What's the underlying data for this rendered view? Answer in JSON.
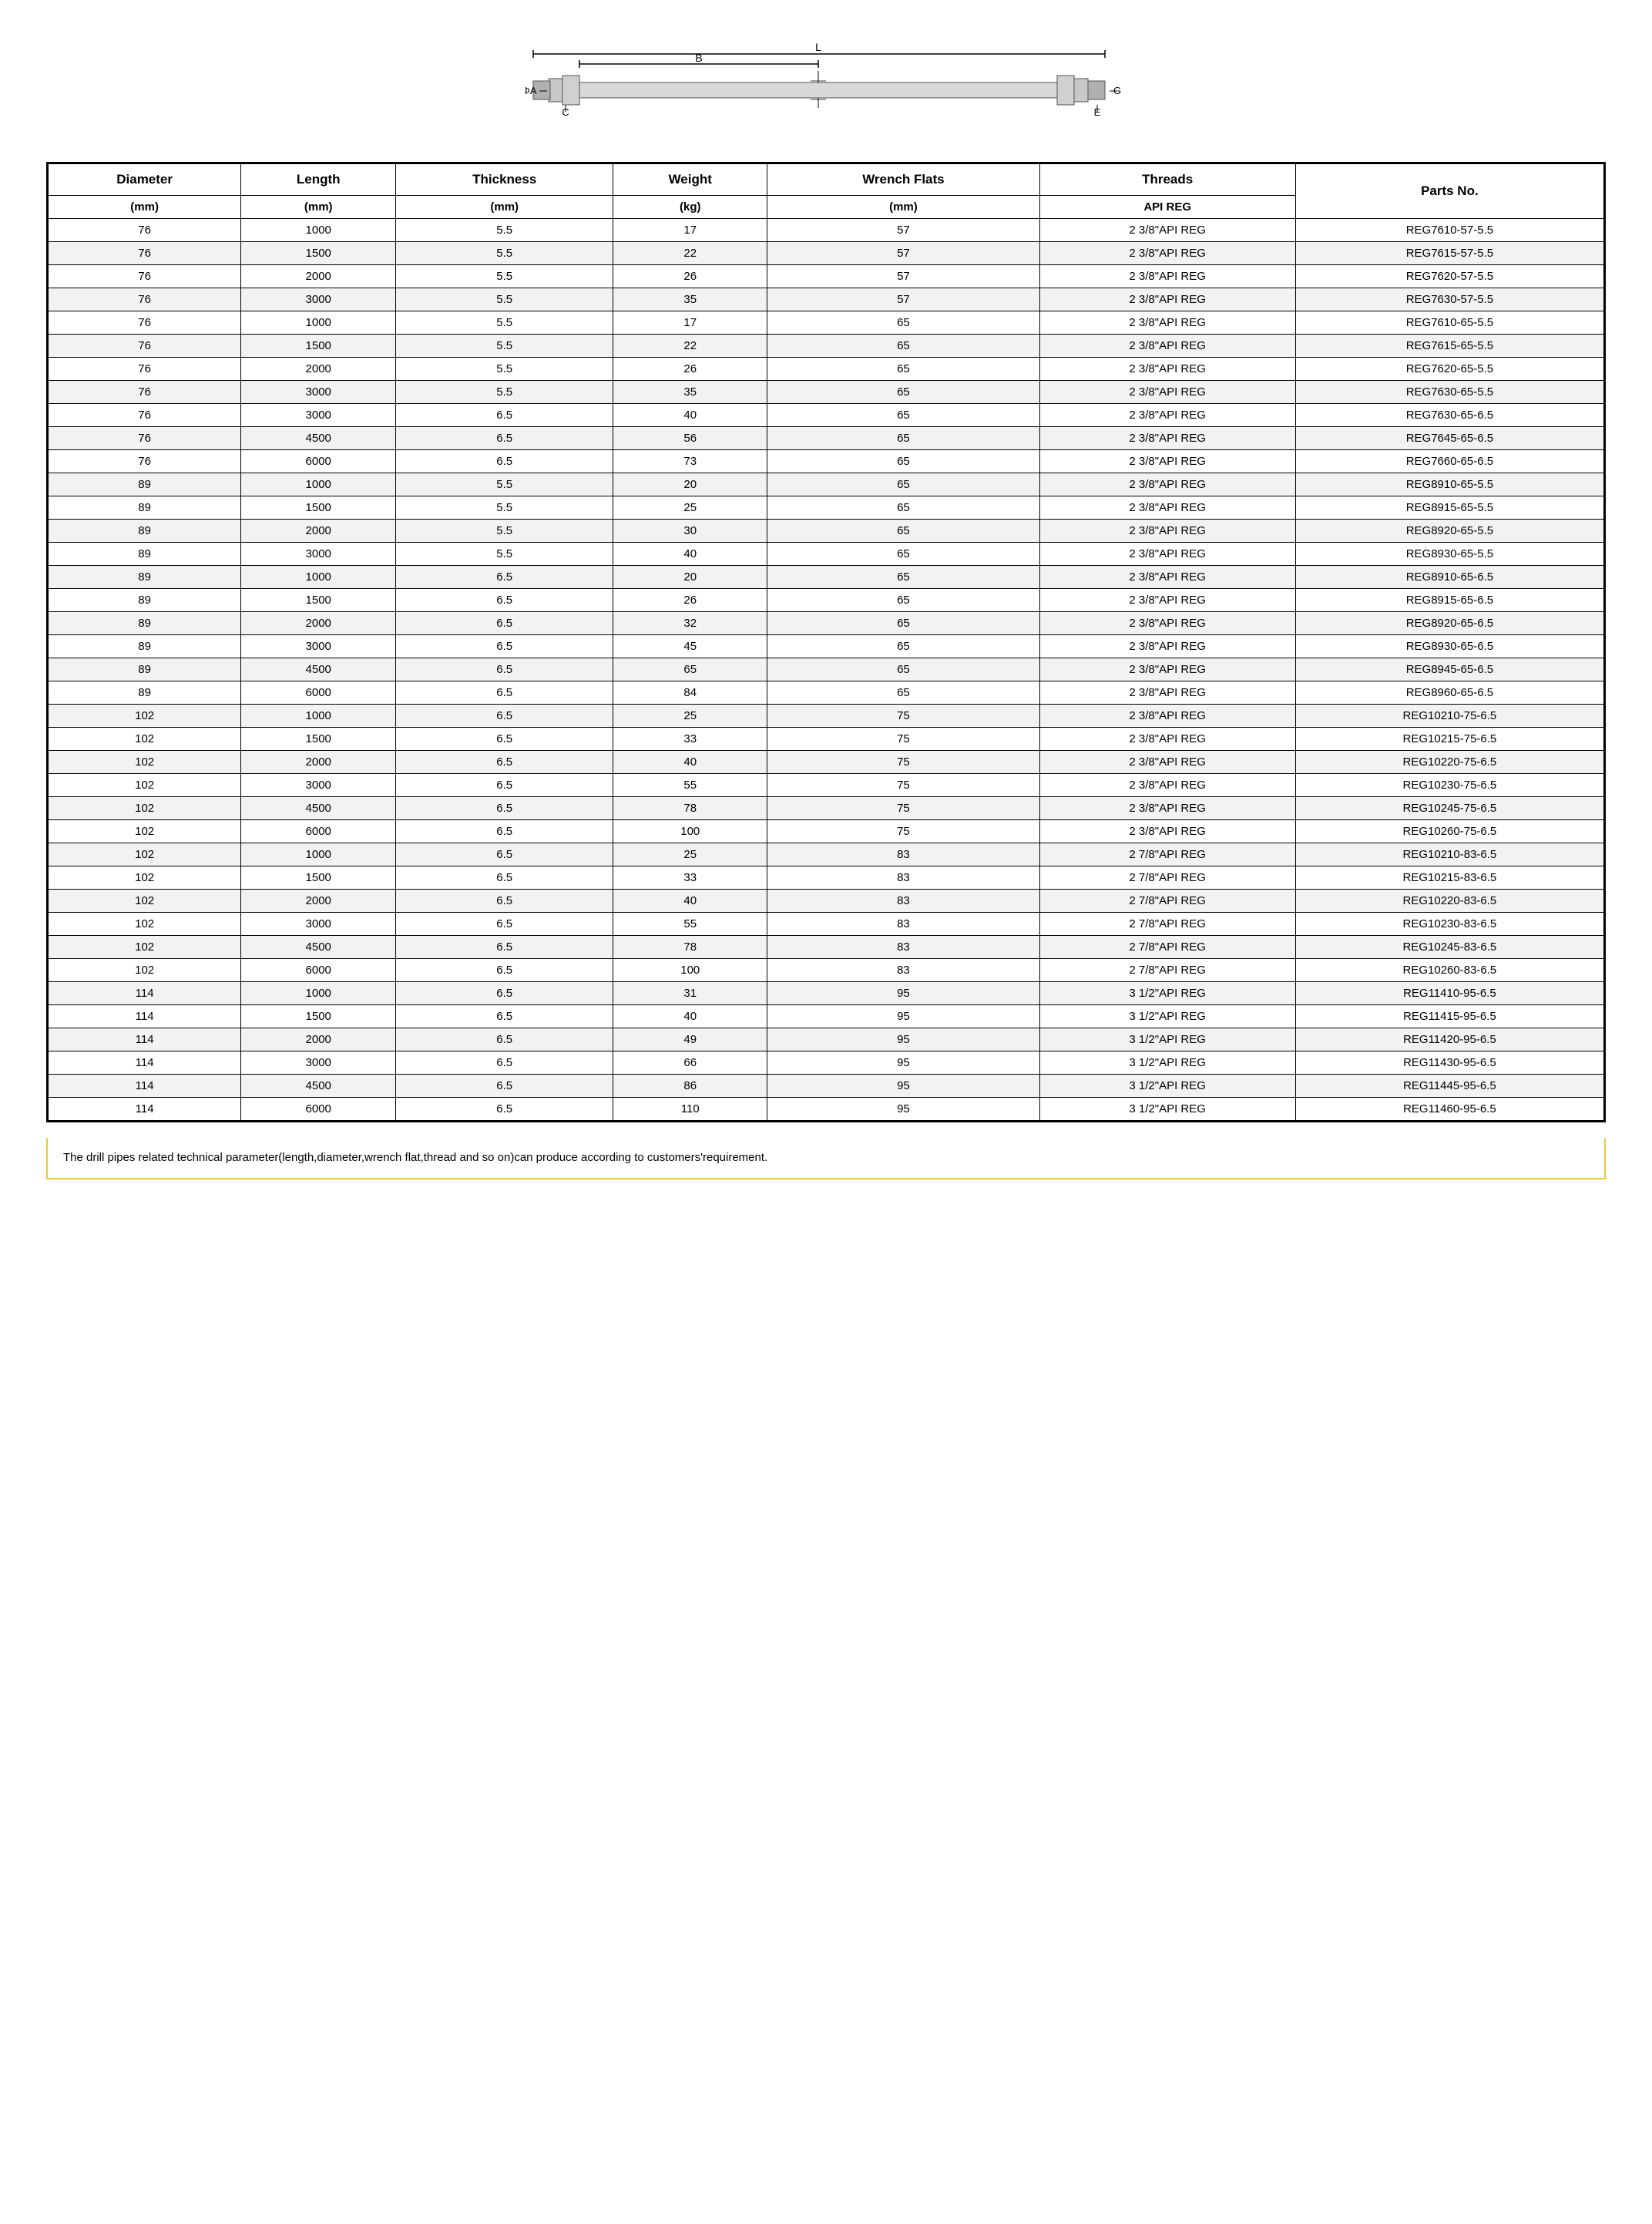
{
  "diagram": {
    "alt": "Drill pipe technical diagram showing dimensions L, B, A, C, E, G"
  },
  "table": {
    "headers": [
      {
        "line1": "Diameter",
        "line2": "(mm)"
      },
      {
        "line1": "Length",
        "line2": "(mm)"
      },
      {
        "line1": "Thickness",
        "line2": "(mm)"
      },
      {
        "line1": "Weight",
        "line2": "(kg)"
      },
      {
        "line1": "Wrench Flats",
        "line2": "(mm)"
      },
      {
        "line1": "Threads",
        "line2": "API REG"
      },
      {
        "line1": "Parts No.",
        "line2": ""
      }
    ],
    "rows": [
      [
        76,
        1000,
        5.5,
        17,
        57,
        "2 3/8\"API REG",
        "REG7610-57-5.5"
      ],
      [
        76,
        1500,
        5.5,
        22,
        57,
        "2 3/8\"API REG",
        "REG7615-57-5.5"
      ],
      [
        76,
        2000,
        5.5,
        26,
        57,
        "2 3/8\"API REG",
        "REG7620-57-5.5"
      ],
      [
        76,
        3000,
        5.5,
        35,
        57,
        "2 3/8\"API REG",
        "REG7630-57-5.5"
      ],
      [
        76,
        1000,
        5.5,
        17,
        65,
        "2 3/8\"API REG",
        "REG7610-65-5.5"
      ],
      [
        76,
        1500,
        5.5,
        22,
        65,
        "2 3/8\"API REG",
        "REG7615-65-5.5"
      ],
      [
        76,
        2000,
        5.5,
        26,
        65,
        "2 3/8\"API REG",
        "REG7620-65-5.5"
      ],
      [
        76,
        3000,
        5.5,
        35,
        65,
        "2 3/8\"API REG",
        "REG7630-65-5.5"
      ],
      [
        76,
        3000,
        6.5,
        40,
        65,
        "2 3/8\"API REG",
        "REG7630-65-6.5"
      ],
      [
        76,
        4500,
        6.5,
        56,
        65,
        "2 3/8\"API REG",
        "REG7645-65-6.5"
      ],
      [
        76,
        6000,
        6.5,
        73,
        65,
        "2 3/8\"API REG",
        "REG7660-65-6.5"
      ],
      [
        89,
        1000,
        5.5,
        20,
        65,
        "2 3/8\"API REG",
        "REG8910-65-5.5"
      ],
      [
        89,
        1500,
        5.5,
        25,
        65,
        "2 3/8\"API REG",
        "REG8915-65-5.5"
      ],
      [
        89,
        2000,
        5.5,
        30,
        65,
        "2 3/8\"API REG",
        "REG8920-65-5.5"
      ],
      [
        89,
        3000,
        5.5,
        40,
        65,
        "2 3/8\"API REG",
        "REG8930-65-5.5"
      ],
      [
        89,
        1000,
        6.5,
        20,
        65,
        "2 3/8\"API REG",
        "REG8910-65-6.5"
      ],
      [
        89,
        1500,
        6.5,
        26,
        65,
        "2 3/8\"API REG",
        "REG8915-65-6.5"
      ],
      [
        89,
        2000,
        6.5,
        32,
        65,
        "2 3/8\"API REG",
        "REG8920-65-6.5"
      ],
      [
        89,
        3000,
        6.5,
        45,
        65,
        "2 3/8\"API REG",
        "REG8930-65-6.5"
      ],
      [
        89,
        4500,
        6.5,
        65,
        65,
        "2 3/8\"API REG",
        "REG8945-65-6.5"
      ],
      [
        89,
        6000,
        6.5,
        84,
        65,
        "2 3/8\"API REG",
        "REG8960-65-6.5"
      ],
      [
        102,
        1000,
        6.5,
        25,
        75,
        "2 3/8\"API REG",
        "REG10210-75-6.5"
      ],
      [
        102,
        1500,
        6.5,
        33,
        75,
        "2 3/8\"API REG",
        "REG10215-75-6.5"
      ],
      [
        102,
        2000,
        6.5,
        40,
        75,
        "2 3/8\"API REG",
        "REG10220-75-6.5"
      ],
      [
        102,
        3000,
        6.5,
        55,
        75,
        "2 3/8\"API REG",
        "REG10230-75-6.5"
      ],
      [
        102,
        4500,
        6.5,
        78,
        75,
        "2 3/8\"API REG",
        "REG10245-75-6.5"
      ],
      [
        102,
        6000,
        6.5,
        100,
        75,
        "2 3/8\"API REG",
        "REG10260-75-6.5"
      ],
      [
        102,
        1000,
        6.5,
        25,
        83,
        "2 7/8\"API REG",
        "REG10210-83-6.5"
      ],
      [
        102,
        1500,
        6.5,
        33,
        83,
        "2 7/8\"API REG",
        "REG10215-83-6.5"
      ],
      [
        102,
        2000,
        6.5,
        40,
        83,
        "2 7/8\"API REG",
        "REG10220-83-6.5"
      ],
      [
        102,
        3000,
        6.5,
        55,
        83,
        "2 7/8\"API REG",
        "REG10230-83-6.5"
      ],
      [
        102,
        4500,
        6.5,
        78,
        83,
        "2 7/8\"API REG",
        "REG10245-83-6.5"
      ],
      [
        102,
        6000,
        6.5,
        100,
        83,
        "2 7/8\"API REG",
        "REG10260-83-6.5"
      ],
      [
        114,
        1000,
        6.5,
        31,
        95,
        "3 1/2\"API REG",
        "REG11410-95-6.5"
      ],
      [
        114,
        1500,
        6.5,
        40,
        95,
        "3 1/2\"API REG",
        "REG11415-95-6.5"
      ],
      [
        114,
        2000,
        6.5,
        49,
        95,
        "3 1/2\"API REG",
        "REG11420-95-6.5"
      ],
      [
        114,
        3000,
        6.5,
        66,
        95,
        "3 1/2\"API REG",
        "REG11430-95-6.5"
      ],
      [
        114,
        4500,
        6.5,
        86,
        95,
        "3 1/2\"API REG",
        "REG11445-95-6.5"
      ],
      [
        114,
        6000,
        6.5,
        110,
        95,
        "3 1/2\"API REG",
        "REG11460-95-6.5"
      ]
    ]
  },
  "footer": {
    "text": "The drill pipes related technical parameter(length,diameter,wrench flat,thread and so on)can produce according to customers'requirement."
  }
}
